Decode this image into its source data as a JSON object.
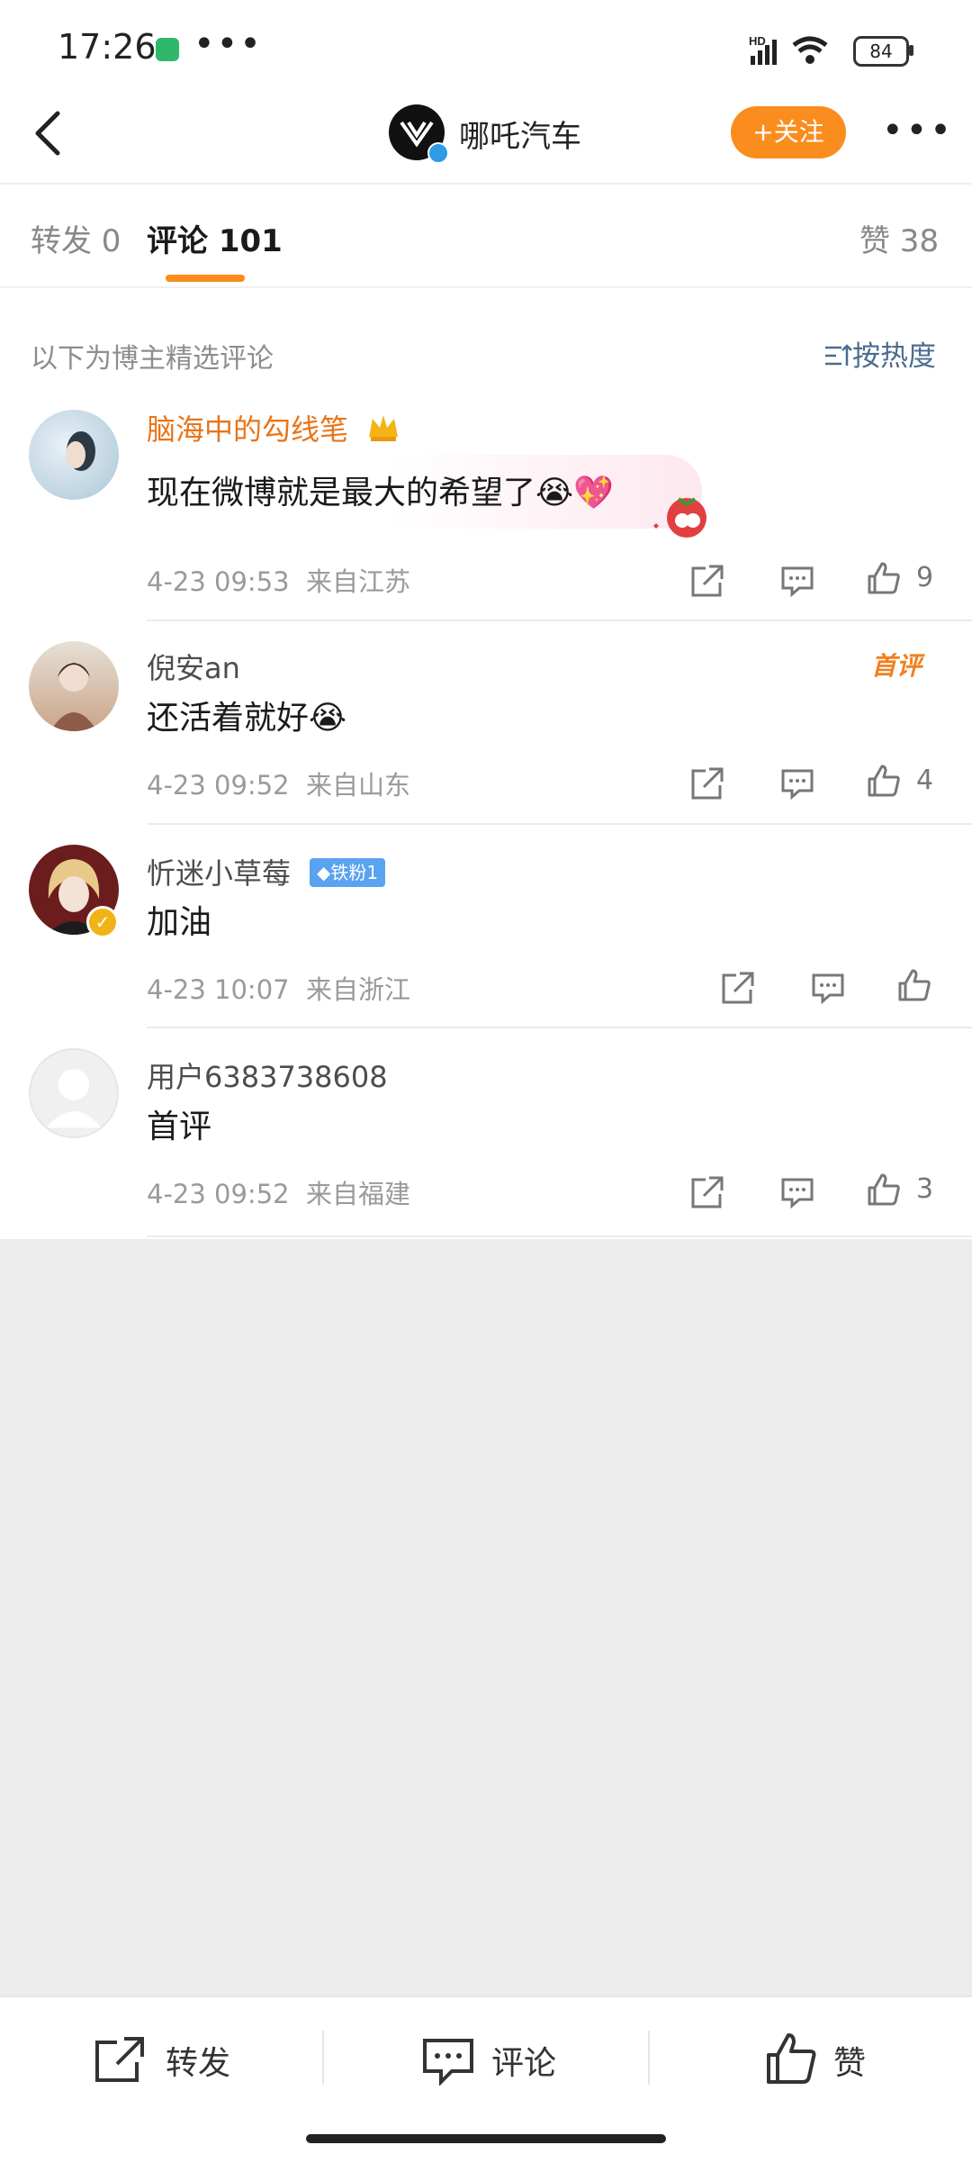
{
  "status_bar": {
    "time": "17:26",
    "dots": "•••",
    "network": "HD",
    "battery": "84"
  },
  "header": {
    "account_name": "哪吒汽车",
    "follow_label": "+关注",
    "more": "•••"
  },
  "tabs": [
    {
      "label": "转发 0"
    },
    {
      "label": "评论 101"
    },
    {
      "label": "赞 38"
    }
  ],
  "comments_section": {
    "note": "以下为博主精选评论",
    "sort_label": "按热度"
  },
  "comments": [
    {
      "user": "脑海中的勾线笔",
      "text": "现在微博就是最大的希望了😭💖",
      "time": "4-23 09:53",
      "location": "来自江苏",
      "likes": "9"
    },
    {
      "user": "倪安an",
      "text": "还活着就好😭",
      "time": "4-23 09:52",
      "location": "来自山东",
      "likes": "4",
      "badge": "首评"
    },
    {
      "user": "忻迷小草莓",
      "fan_badge": "铁粉1",
      "text": "加油",
      "time": "4-23 10:07",
      "location": "来自浙江",
      "likes": ""
    },
    {
      "user": "用户6383738608",
      "text": "首评",
      "time": "4-23 09:52",
      "location": "来自福建",
      "likes": "3"
    }
  ],
  "bottom_bar": {
    "repost": "转发",
    "comment": "评论",
    "like": "赞"
  },
  "colors": {
    "accent": "#fb8c1e",
    "vip_name": "#e8751a",
    "sort": "#4a6d8e",
    "fan_badge": "#5aa3f0"
  }
}
